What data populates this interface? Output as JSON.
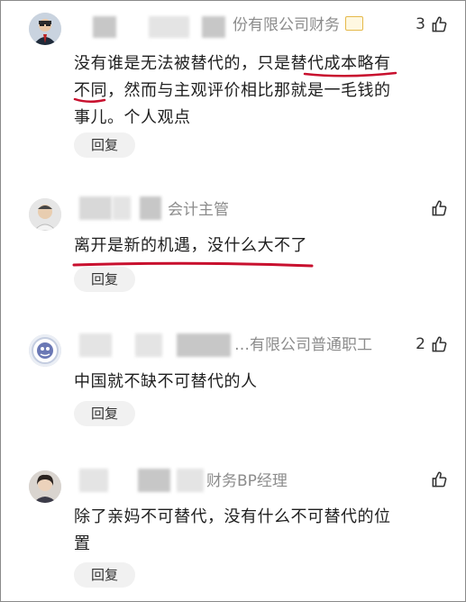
{
  "comments": [
    {
      "title": "份有限公司财务",
      "likes": "3",
      "text": "没有谁是无法被替代的，只是替代成本略有不同，然而与主观评价相比那就是一毛钱的事儿。个人观点",
      "lines": [
        "没有谁是无法被替代的，只是替代成本略有",
        "不同，然而与主观评价相比那就是一毛钱的",
        "事儿。个人观点"
      ],
      "reply": "回复"
    },
    {
      "title": "会计主管",
      "likes": "",
      "lines": [
        "离开是新的机遇，没什么大不了"
      ],
      "reply": "回复"
    },
    {
      "title": "…有限公司普通职工",
      "likes": "2",
      "lines": [
        "中国就不缺不可替代的人"
      ],
      "reply": "回复"
    },
    {
      "title": "财务BP经理",
      "likes": "",
      "lines": [
        "除了亲妈不可替代，没有什么不可替代的位",
        "置"
      ],
      "reply": "回复"
    }
  ],
  "icons": {
    "like": "thumbs-up-icon",
    "badge": "level-badge-icon"
  },
  "colors": {
    "annotation": "#c8102e",
    "title": "#8c8c8c",
    "reply_bg": "#f1f1f1"
  }
}
